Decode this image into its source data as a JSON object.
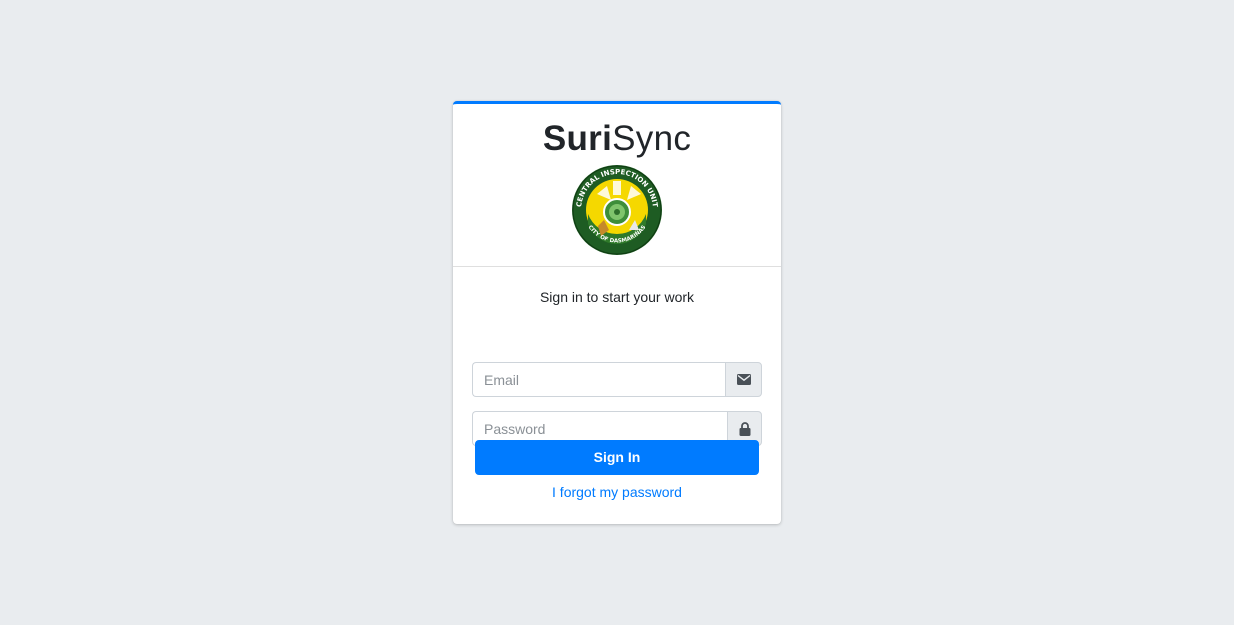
{
  "brand": {
    "bold": "Suri",
    "light": "Sync",
    "logo_icon": "central-inspection-unit-seal"
  },
  "login": {
    "message": "Sign in to start your work",
    "email": {
      "placeholder": "Email",
      "value": "",
      "icon": "envelope-icon"
    },
    "password": {
      "placeholder": "Password",
      "value": "",
      "icon": "lock-icon"
    },
    "submit_label": "Sign In",
    "forgot_label": "I forgot my password"
  },
  "colors": {
    "accent": "#007bff",
    "background": "#e9ecef",
    "seal_green": "#1e5c23",
    "seal_yellow": "#f5d800"
  }
}
